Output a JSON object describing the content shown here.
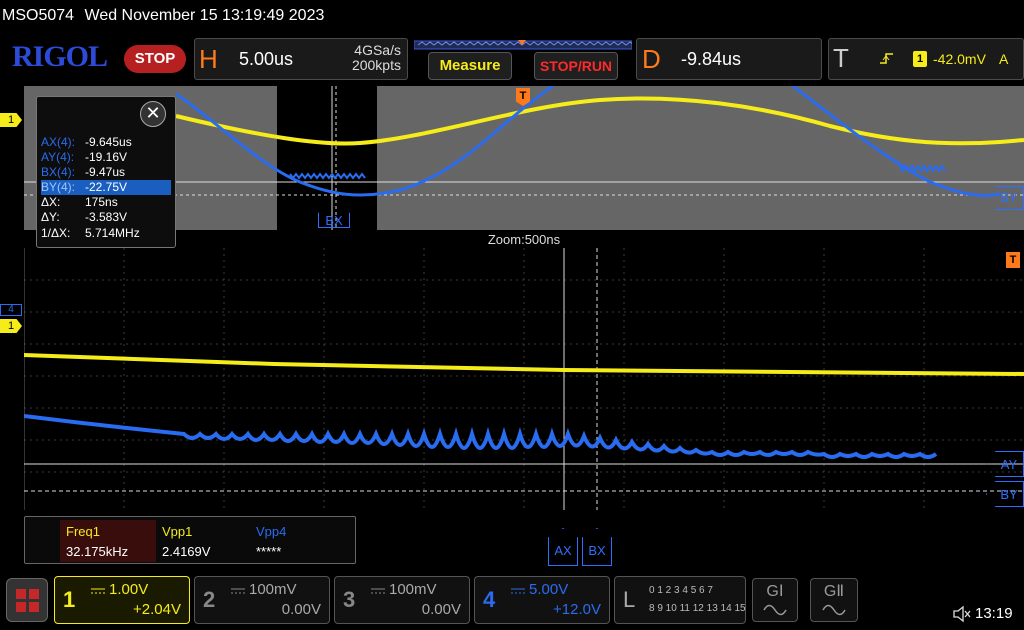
{
  "status": {
    "model": "MSO5074",
    "datetime": "Wed November 15 13:19:49 2023"
  },
  "toolbar": {
    "logo": "RIGOL",
    "stop_label": "STOP",
    "horizontal": {
      "letter": "H",
      "timebase": "5.00us",
      "sample_rate": "4GSa/s",
      "memory_depth": "200kpts"
    },
    "measure_label": "Measure",
    "stop_run_label": "STOP/RUN",
    "delay": {
      "letter": "D",
      "value": "-9.84us"
    },
    "trigger": {
      "letter": "T",
      "source": "1",
      "level": "-42.0mV",
      "mode": "A"
    }
  },
  "cursor_panel": {
    "rows": [
      {
        "key": "AX(4):",
        "value": "-9.645us"
      },
      {
        "key": "AY(4):",
        "value": "-19.16V"
      },
      {
        "key": "BX(4):",
        "value": "-9.47us"
      },
      {
        "key": "BY(4):",
        "value": "-22.75V"
      },
      {
        "key": "ΔX:",
        "value": "175ns"
      },
      {
        "key": "ΔY:",
        "value": "-3.583V"
      },
      {
        "key": "1/ΔX:",
        "value": "5.714MHz"
      }
    ],
    "close_symbol": "✕"
  },
  "waveform": {
    "zoom_label": "Zoom:500ns",
    "markers": {
      "ax": "AX",
      "bx": "BX",
      "ay": "AY",
      "by": "BY",
      "trigger": "T",
      "ch1": "1",
      "ch4": "4"
    },
    "colors": {
      "ch1": "#f5ec1a",
      "ch4": "#2a6cf0"
    }
  },
  "measurements": {
    "items": [
      {
        "label": "Freq1",
        "value": "32.175kHz"
      },
      {
        "label": "Vpp1",
        "value": "2.4169V"
      },
      {
        "label": "Vpp4",
        "value": "*****"
      }
    ]
  },
  "channels": [
    {
      "num": "1",
      "scale": "1.00V",
      "offset": "+2.04V"
    },
    {
      "num": "2",
      "scale": "100mV",
      "offset": "0.00V"
    },
    {
      "num": "3",
      "scale": "100mV",
      "offset": "0.00V"
    },
    {
      "num": "4",
      "scale": "5.00V",
      "offset": "+12.0V"
    }
  ],
  "logic": {
    "letter": "L",
    "row1": "0 1 2 3  4 5 6 7",
    "row2": "8 9 10 11 12 13 14 15"
  },
  "generators": {
    "g1": "GⅠ",
    "g2": "GⅡ"
  },
  "clock": "13:19"
}
